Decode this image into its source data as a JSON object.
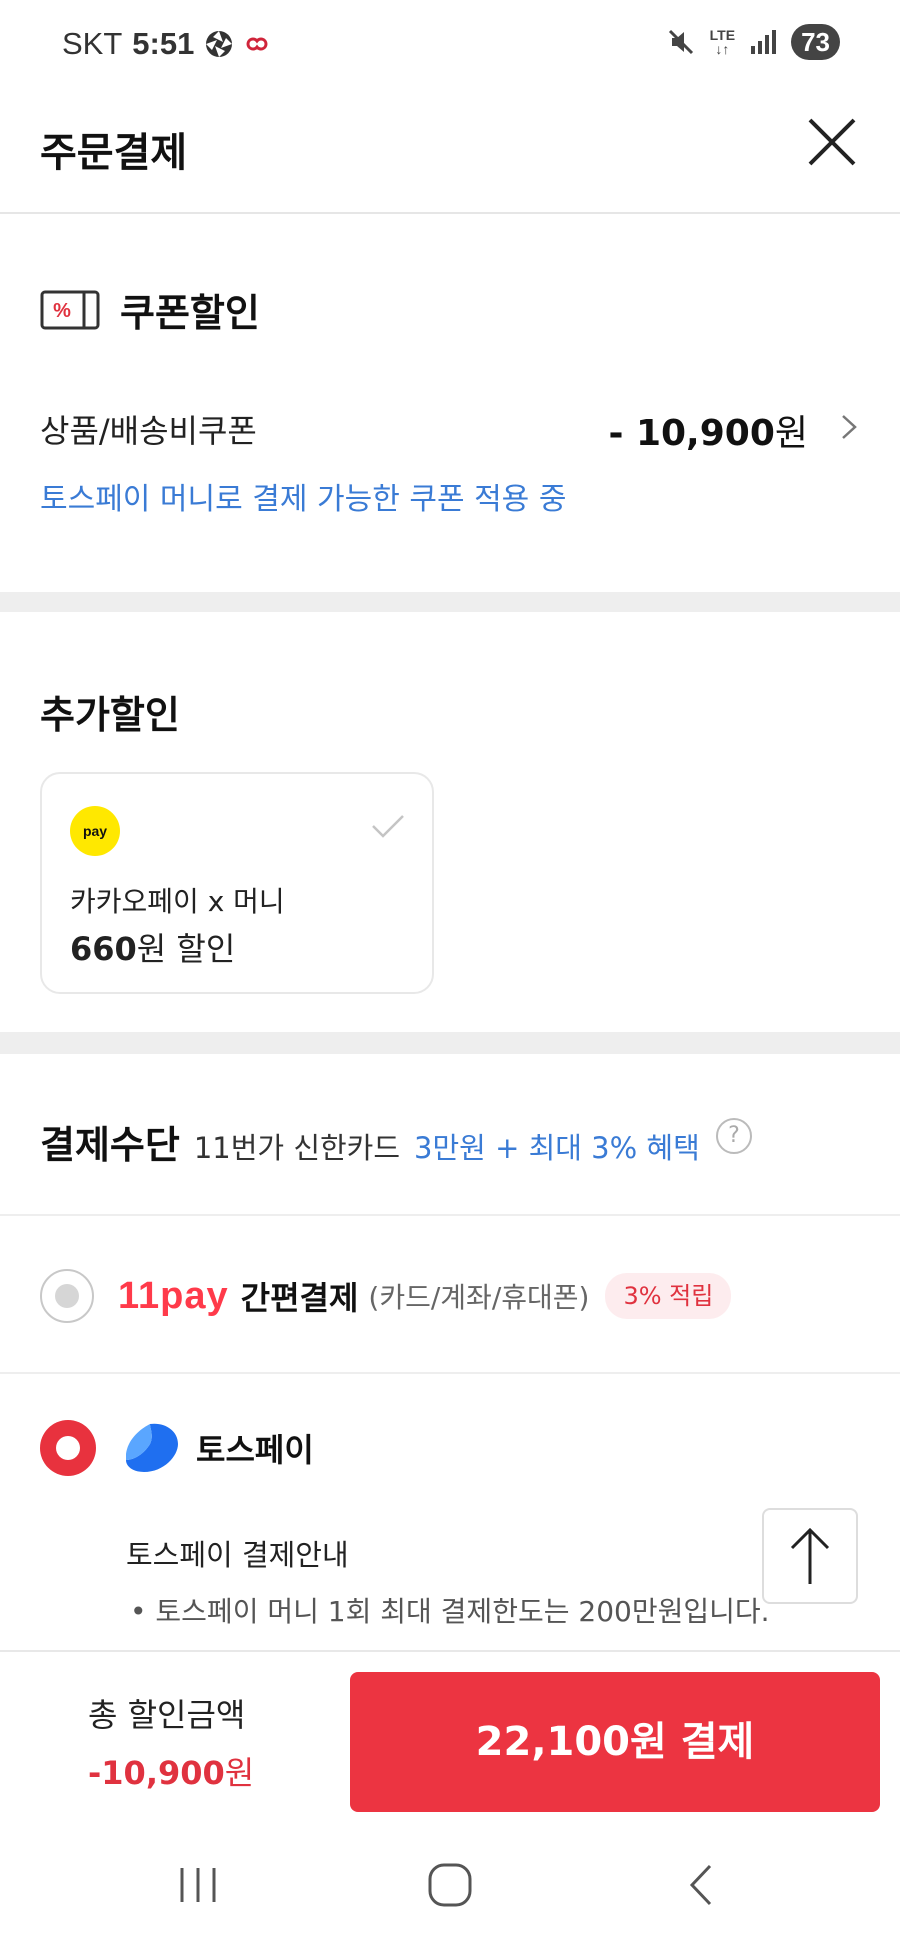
{
  "status_bar": {
    "carrier": "SKT",
    "time": "5:51",
    "network": "LTE",
    "battery": "73"
  },
  "header": {
    "title": "주문결제"
  },
  "coupon": {
    "title": "쿠폰할인",
    "row_label": "상품/배송비쿠폰",
    "amount_value": "- 10,900",
    "amount_unit": "원",
    "note": "토스페이 머니로 결제 가능한 쿠폰 적용 중"
  },
  "extra_discount": {
    "title": "추가할인",
    "card": {
      "logo_text": "pay",
      "name": "카카오페이 x 머니",
      "amount": "660",
      "suffix": "원 할인"
    }
  },
  "payment": {
    "title": "결제수단",
    "promo_text": "11번가 신한카드",
    "promo_highlight": "3만원 + 최대 3% 혜택",
    "help": "?",
    "option1": {
      "logo_num": "11",
      "logo_word": "pay",
      "name": "간편결제",
      "sub": "(카드/계좌/휴대폰)",
      "badge": "3% 적립",
      "selected": false
    },
    "option2": {
      "name": "토스페이",
      "selected": true,
      "guide_title": "토스페이 결제안내",
      "guide_item": "• 토스페이 머니 1회 최대 결제한도는 200만원입니다."
    }
  },
  "bottom": {
    "total_label": "총 할인금액",
    "total_value": "-10,900",
    "total_unit": "원",
    "pay_button": "22,100원 결제"
  },
  "colors": {
    "accent_red": "#ec3441",
    "link_blue": "#3a7bd5",
    "kakao_yellow": "#ffe800"
  }
}
